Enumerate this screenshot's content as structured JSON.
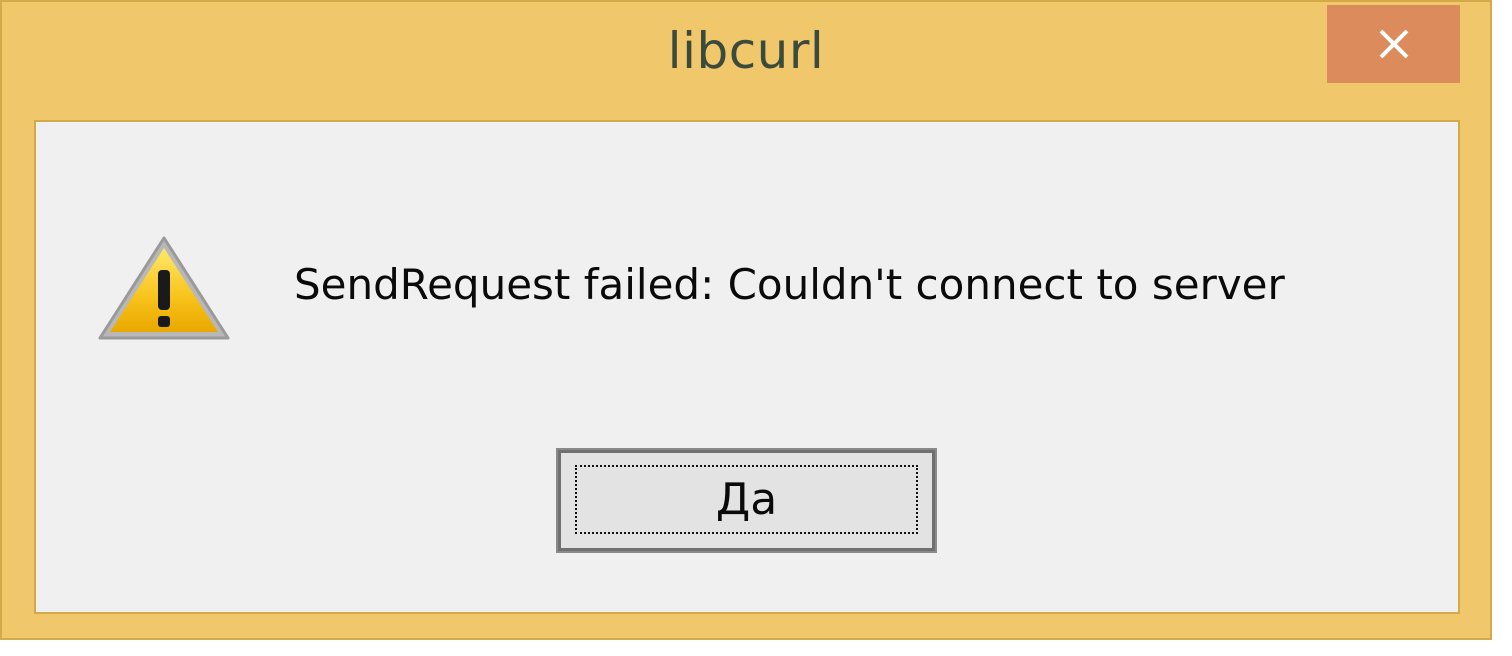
{
  "window": {
    "title": "libcurl",
    "close_icon": "close-icon",
    "colors": {
      "frame": "#f0c76b",
      "close_button": "#db8b5c",
      "client": "#f0f0f0"
    }
  },
  "dialog": {
    "icon": "warning-icon",
    "message": "SendRequest failed: Couldn't connect to server",
    "ok_label": "Да"
  }
}
